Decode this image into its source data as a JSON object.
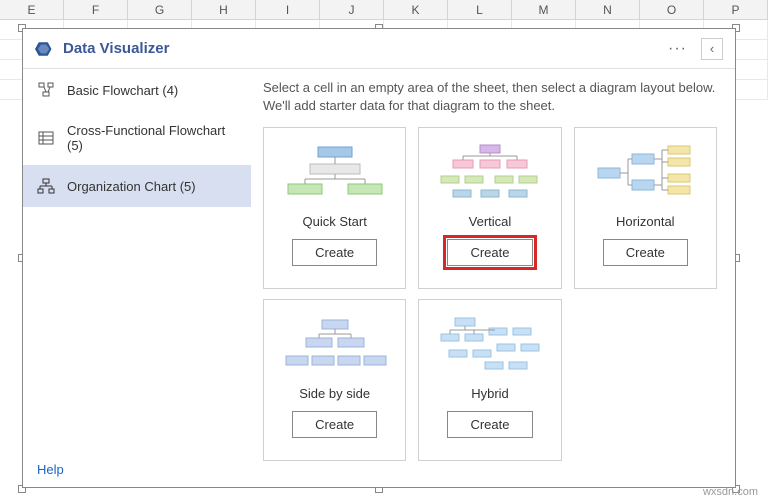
{
  "columns": [
    "E",
    "F",
    "G",
    "H",
    "I",
    "J",
    "K",
    "L",
    "M",
    "N",
    "O",
    "P"
  ],
  "panel": {
    "title": "Data Visualizer",
    "collapse_glyph": "‹"
  },
  "sidebar": {
    "items": [
      {
        "label": "Basic Flowchart (4)",
        "icon": "flowchart-icon",
        "active": false
      },
      {
        "label": "Cross-Functional Flowchart (5)",
        "icon": "swimlane-icon",
        "active": false
      },
      {
        "label": "Organization Chart (5)",
        "icon": "orgchart-icon",
        "active": true
      }
    ],
    "help_label": "Help"
  },
  "content": {
    "instructions": "Select a cell in an empty area of the sheet, then select a diagram layout below. We'll add starter data for that diagram to the sheet.",
    "create_label": "Create",
    "cards": [
      {
        "title": "Quick Start",
        "highlight": false
      },
      {
        "title": "Vertical",
        "highlight": true
      },
      {
        "title": "Horizontal",
        "highlight": false
      },
      {
        "title": "Side by side",
        "highlight": false
      },
      {
        "title": "Hybrid",
        "highlight": false
      }
    ]
  },
  "watermark": "wxsdn.com"
}
